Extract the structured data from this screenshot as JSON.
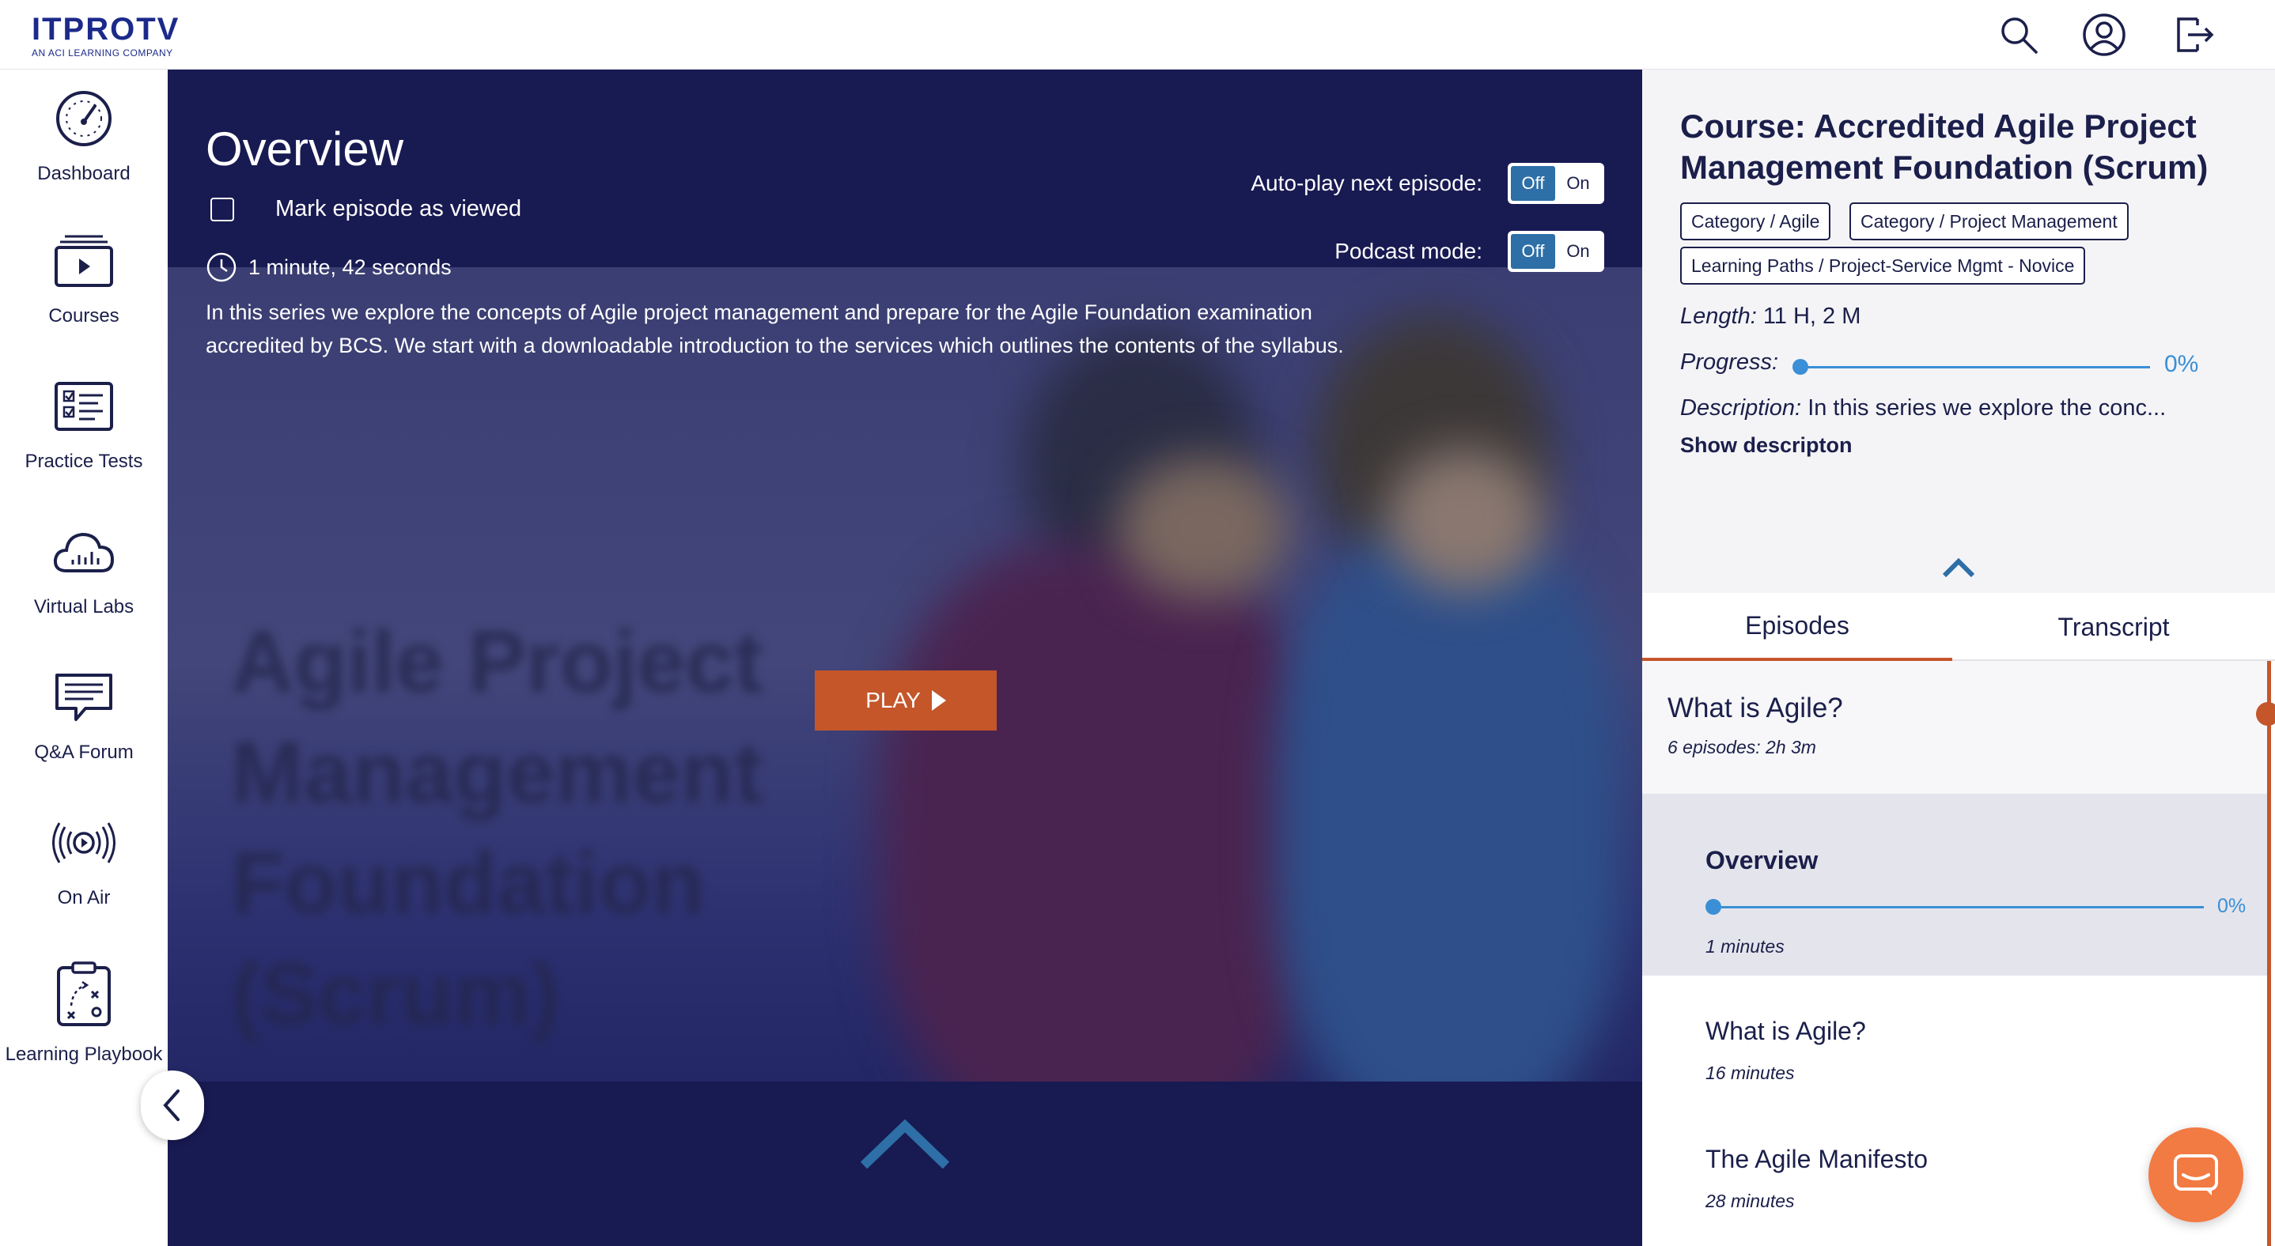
{
  "header": {
    "logo_main": "ITPROTV",
    "logo_sub": "AN ACI LEARNING COMPANY",
    "icons": [
      "search-icon",
      "account-icon",
      "logout-icon"
    ]
  },
  "sidebar": {
    "items": [
      {
        "label": "Dashboard",
        "icon": "dashboard-gauge-icon"
      },
      {
        "label": "Courses",
        "icon": "courses-play-icon"
      },
      {
        "label": "Practice Tests",
        "icon": "practice-tests-checklist-icon"
      },
      {
        "label": "Virtual Labs",
        "icon": "virtual-labs-cloud-icon"
      },
      {
        "label": "Q&A Forum",
        "icon": "forum-chat-icon"
      },
      {
        "label": "On Air",
        "icon": "on-air-broadcast-icon"
      },
      {
        "label": "Learning Playbook",
        "icon": "playbook-clipboard-icon"
      }
    ]
  },
  "video": {
    "title": "Overview",
    "mark_viewed_label": "Mark episode as viewed",
    "duration": "1 minute, 42 seconds",
    "description": "In this series we explore the concepts of Agile project management and prepare for the Agile Foundation examination accredited by BCS. We start with a downloadable introduction to the services which outlines the contents of the syllabus.",
    "autoplay_label": "Auto-play next episode:",
    "podcast_label": "Podcast mode:",
    "toggle_off": "Off",
    "toggle_on": "On",
    "play_label": "PLAY",
    "blurred_title": "Agile Project Management Foundation (Scrum)"
  },
  "panel": {
    "course_title": "Course: Accredited Agile Project Management Foundation (Scrum)",
    "tags": [
      "Category / Agile",
      "Category / Project Management",
      "Learning Paths / Project-Service Mgmt - Novice"
    ],
    "length_label": "Length:",
    "length_value": "11 H, 2 M",
    "progress_label": "Progress:",
    "progress_value": "0%",
    "progress_fraction": 0,
    "description_label": "Description:",
    "description_value": "In this series we explore the conc...",
    "show_description": "Show descripton",
    "tabs": [
      "Episodes",
      "Transcript"
    ],
    "module": {
      "title": "What is Agile?",
      "subtitle": "6 episodes: 2h 3m"
    },
    "episodes": [
      {
        "title": "Overview",
        "duration": "1 minutes",
        "progress": "0%"
      },
      {
        "title": "What is Agile?",
        "duration": "16 minutes"
      },
      {
        "title": "The Agile Manifesto",
        "duration": "28 minutes"
      }
    ]
  },
  "colors": {
    "navy": "#1b1f4a",
    "brand": "#1b2a8a",
    "accent": "#c4562a",
    "progress": "#3a8fd6",
    "chat": "#f27a43",
    "video_bg": "#181a52"
  }
}
